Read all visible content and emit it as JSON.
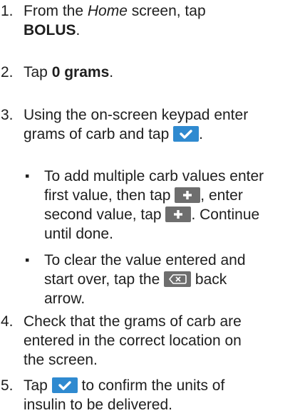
{
  "steps": [
    {
      "num": "1.",
      "lines": [
        "From the ",
        "Home",
        " screen, tap",
        "BOLUS",
        "."
      ]
    },
    {
      "num": "2.",
      "tap": "Tap ",
      "bold": "0 grams",
      "end": "."
    },
    {
      "num": "3.",
      "line1": "Using the on-screen keypad enter",
      "line2a": "grams of carb and tap ",
      "line2b": "."
    },
    {
      "num": "4.",
      "line1": "Check that the grams of carb are",
      "line2": "entered in the correct location on",
      "line3": "the screen."
    },
    {
      "num": "5.",
      "line1a": "Tap ",
      "line1b": " to confirm the units of",
      "line2": "insulin to be delivered."
    }
  ],
  "bullets": [
    {
      "symbol": "▪",
      "line1": "To add multiple carb values enter",
      "line2a": "first value, then tap ",
      "line2b": ", enter",
      "line3a": "second value, tap ",
      "line3b": ". Continue",
      "line4": "until done."
    },
    {
      "symbol": "▪",
      "line1": "To clear the value entered and",
      "line2a": "start over, tap the ",
      "line2b": " back",
      "line3": "arrow."
    }
  ],
  "icons": {
    "confirm": "checkmark-icon",
    "add": "plus-icon",
    "back": "backspace-icon"
  },
  "colors": {
    "confirm_button": "#2f8ad0",
    "plus_button": "#6e6e6e",
    "text": "#1e1e1e"
  }
}
